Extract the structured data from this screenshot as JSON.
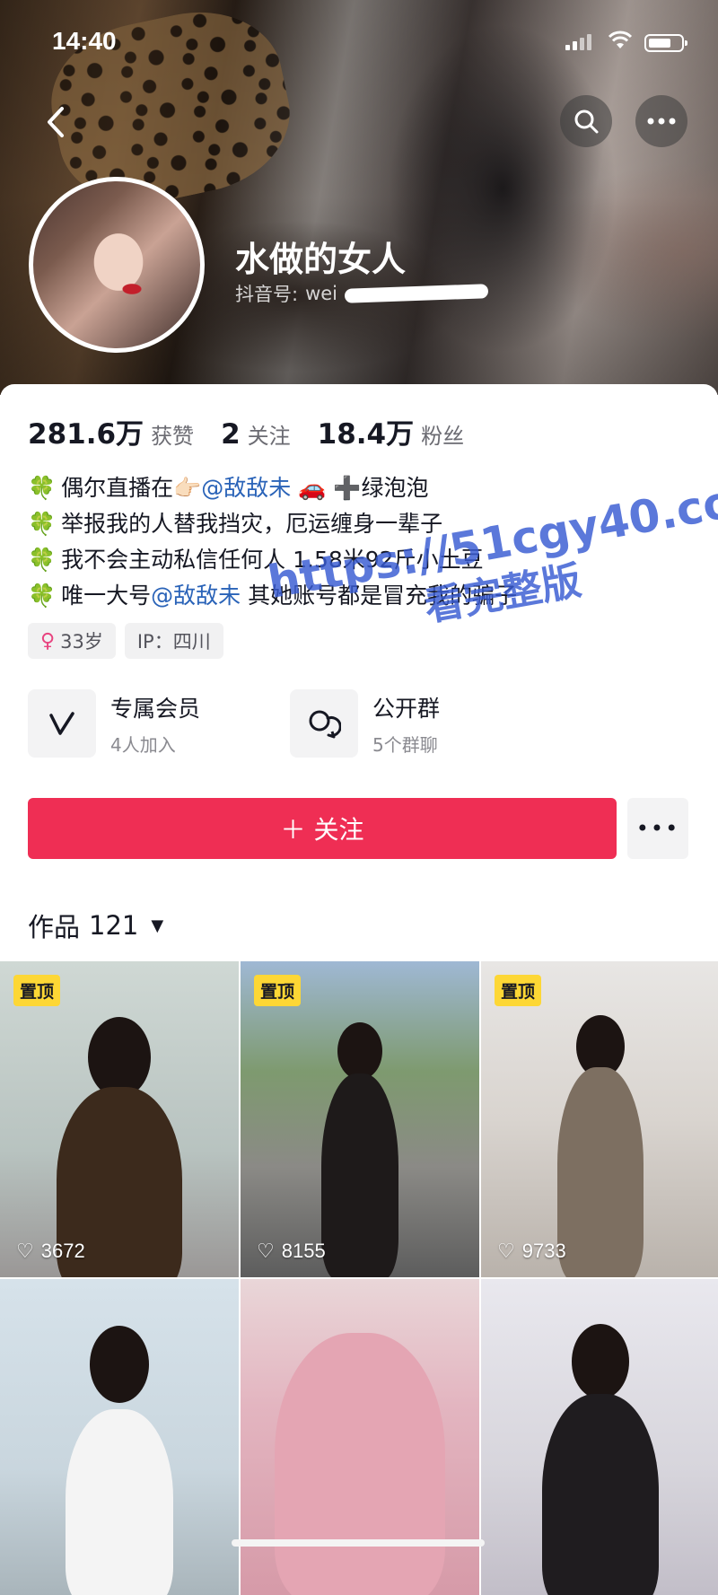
{
  "status_bar": {
    "time": "14:40"
  },
  "profile": {
    "nickname": "水做的女人",
    "douyin_id_label": "抖音号:",
    "douyin_id_value": "wei"
  },
  "stats": [
    {
      "value": "281.6万",
      "label": "获赞"
    },
    {
      "value": "2",
      "label": "关注"
    },
    {
      "value": "18.4万",
      "label": "粉丝"
    }
  ],
  "bio": {
    "line1_prefix": "偶尔直播在👉🏻",
    "line1_mention": "@敌敌未",
    "line1_suffix": " 🚗 ➕绿泡泡",
    "line2": "举报我的人替我挡灾，厄运缠身一辈子",
    "line3": "我不会主动私信任何人  1.58米92斤小土豆",
    "line4_prefix": "唯一大号",
    "line4_mention": "@敌敌未",
    "line4_suffix": " 其她账号都是冒充我的骗子"
  },
  "tags": {
    "age": "33岁",
    "ip": "IP：四川"
  },
  "groups": [
    {
      "title": "专属会员",
      "sub": "4人加入",
      "icon": "v-icon"
    },
    {
      "title": "公开群",
      "sub": "5个群聊",
      "icon": "group-chat-icon"
    }
  ],
  "actions": {
    "follow_label": "＋ 关注",
    "more_label": "•••"
  },
  "works": {
    "label": "作品",
    "count": "121"
  },
  "watermark": {
    "line1": "https://51cgy40.com",
    "line2": "看完整版"
  },
  "grid": {
    "pin_label": "置顶",
    "items": [
      {
        "likes": "3672",
        "pinned": true
      },
      {
        "likes": "8155",
        "pinned": true
      },
      {
        "likes": "9733",
        "pinned": true
      },
      {
        "likes": "",
        "pinned": false
      },
      {
        "likes": "",
        "pinned": false
      },
      {
        "likes": "",
        "pinned": false
      }
    ]
  },
  "colors": {
    "follow_button": "#ef2e54",
    "mention": "#2a63b8",
    "pin_badge": "#fdd735",
    "watermark": "#375ad2"
  }
}
